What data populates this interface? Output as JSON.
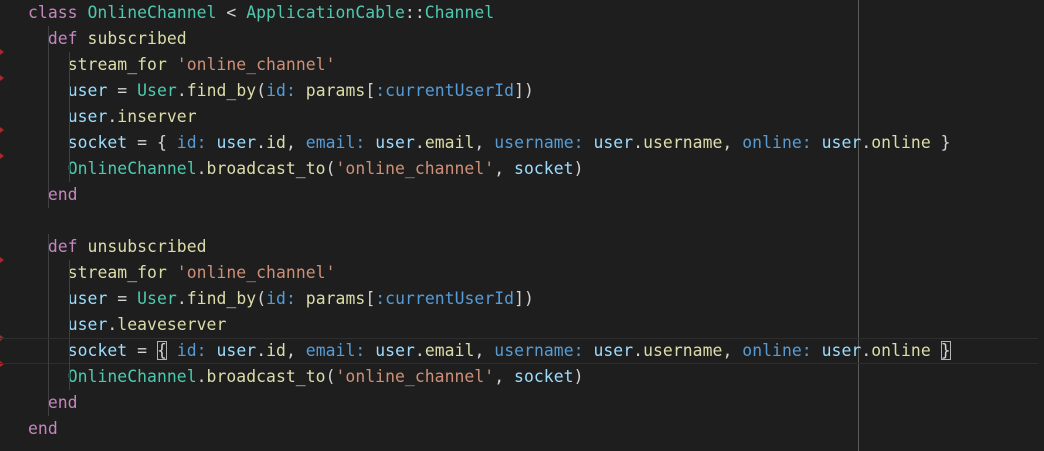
{
  "editor": {
    "language": "ruby",
    "colors": {
      "background": "#1e1e1e",
      "keyword": "#c586c0",
      "class": "#4ec9b0",
      "function": "#dcdcaa",
      "variable": "#9cdcfe",
      "string": "#ce9178",
      "symbol": "#569cd6",
      "plain": "#d4d4d4",
      "git_marker": "#a8282c"
    },
    "current_line": 14,
    "lines": [
      {
        "indent": 0,
        "tokens": [
          [
            "kw",
            "class"
          ],
          [
            "op",
            " "
          ],
          [
            "cls",
            "OnlineChannel"
          ],
          [
            "op",
            " < "
          ],
          [
            "cls",
            "ApplicationCable"
          ],
          [
            "op",
            "::"
          ],
          [
            "cls",
            "Channel"
          ]
        ]
      },
      {
        "indent": 1,
        "tokens": [
          [
            "kw",
            "def"
          ],
          [
            "op",
            " "
          ],
          [
            "fn",
            "subscribed"
          ]
        ]
      },
      {
        "indent": 2,
        "tokens": [
          [
            "fn",
            "stream_for"
          ],
          [
            "op",
            " "
          ],
          [
            "str",
            "'online_channel'"
          ]
        ]
      },
      {
        "indent": 2,
        "tokens": [
          [
            "var",
            "user"
          ],
          [
            "op",
            " = "
          ],
          [
            "cls",
            "User"
          ],
          [
            "op",
            "."
          ],
          [
            "fn",
            "find_by"
          ],
          [
            "op",
            "("
          ],
          [
            "sym",
            "id:"
          ],
          [
            "op",
            " "
          ],
          [
            "fn",
            "params"
          ],
          [
            "op",
            "["
          ],
          [
            "sym",
            ":currentUserId"
          ],
          [
            "op",
            "])"
          ]
        ]
      },
      {
        "indent": 2,
        "tokens": [
          [
            "var",
            "user"
          ],
          [
            "op",
            "."
          ],
          [
            "fn",
            "inserver"
          ]
        ]
      },
      {
        "indent": 2,
        "tokens": [
          [
            "var",
            "socket"
          ],
          [
            "op",
            " = { "
          ],
          [
            "sym",
            "id:"
          ],
          [
            "op",
            " "
          ],
          [
            "var",
            "user"
          ],
          [
            "op",
            "."
          ],
          [
            "fn",
            "id"
          ],
          [
            "op",
            ", "
          ],
          [
            "sym",
            "email:"
          ],
          [
            "op",
            " "
          ],
          [
            "var",
            "user"
          ],
          [
            "op",
            "."
          ],
          [
            "fn",
            "email"
          ],
          [
            "op",
            ", "
          ],
          [
            "sym",
            "username:"
          ],
          [
            "op",
            " "
          ],
          [
            "var",
            "user"
          ],
          [
            "op",
            "."
          ],
          [
            "fn",
            "username"
          ],
          [
            "op",
            ", "
          ],
          [
            "sym",
            "online:"
          ],
          [
            "op",
            " "
          ],
          [
            "var",
            "user"
          ],
          [
            "op",
            "."
          ],
          [
            "fn",
            "online"
          ],
          [
            "op",
            " }"
          ]
        ]
      },
      {
        "indent": 2,
        "tokens": [
          [
            "cls",
            "OnlineChannel"
          ],
          [
            "op",
            "."
          ],
          [
            "fn",
            "broadcast_to"
          ],
          [
            "op",
            "("
          ],
          [
            "str",
            "'online_channel'"
          ],
          [
            "op",
            ", "
          ],
          [
            "var",
            "socket"
          ],
          [
            "op",
            ")"
          ]
        ]
      },
      {
        "indent": 1,
        "tokens": [
          [
            "kw",
            "end"
          ]
        ]
      },
      {
        "indent": 0,
        "tokens": []
      },
      {
        "indent": 1,
        "tokens": [
          [
            "kw",
            "def"
          ],
          [
            "op",
            " "
          ],
          [
            "fn",
            "unsubscribed"
          ]
        ]
      },
      {
        "indent": 2,
        "tokens": [
          [
            "fn",
            "stream_for"
          ],
          [
            "op",
            " "
          ],
          [
            "str",
            "'online_channel'"
          ]
        ]
      },
      {
        "indent": 2,
        "tokens": [
          [
            "var",
            "user"
          ],
          [
            "op",
            " = "
          ],
          [
            "cls",
            "User"
          ],
          [
            "op",
            "."
          ],
          [
            "fn",
            "find_by"
          ],
          [
            "op",
            "("
          ],
          [
            "sym",
            "id:"
          ],
          [
            "op",
            " "
          ],
          [
            "fn",
            "params"
          ],
          [
            "op",
            "["
          ],
          [
            "sym",
            ":currentUserId"
          ],
          [
            "op",
            "])"
          ]
        ]
      },
      {
        "indent": 2,
        "tokens": [
          [
            "var",
            "user"
          ],
          [
            "op",
            "."
          ],
          [
            "fn",
            "leaveserver"
          ]
        ]
      },
      {
        "indent": 2,
        "tokens": [
          [
            "var",
            "socket"
          ],
          [
            "op",
            " = "
          ],
          [
            "bro",
            "{"
          ],
          [
            "op",
            " "
          ],
          [
            "sym",
            "id:"
          ],
          [
            "op",
            " "
          ],
          [
            "var",
            "user"
          ],
          [
            "op",
            "."
          ],
          [
            "fn",
            "id"
          ],
          [
            "op",
            ", "
          ],
          [
            "sym",
            "email:"
          ],
          [
            "op",
            " "
          ],
          [
            "var",
            "user"
          ],
          [
            "op",
            "."
          ],
          [
            "fn",
            "email"
          ],
          [
            "op",
            ", "
          ],
          [
            "sym",
            "username:"
          ],
          [
            "op",
            " "
          ],
          [
            "var",
            "user"
          ],
          [
            "op",
            "."
          ],
          [
            "fn",
            "username"
          ],
          [
            "op",
            ", "
          ],
          [
            "sym",
            "online:"
          ],
          [
            "op",
            " "
          ],
          [
            "var",
            "user"
          ],
          [
            "op",
            "."
          ],
          [
            "fn",
            "online"
          ],
          [
            "op",
            " "
          ],
          [
            "brc",
            "}"
          ]
        ]
      },
      {
        "indent": 2,
        "tokens": [
          [
            "cls",
            "OnlineChannel"
          ],
          [
            "op",
            "."
          ],
          [
            "fn",
            "broadcast_to"
          ],
          [
            "op",
            "("
          ],
          [
            "str",
            "'online_channel'"
          ],
          [
            "op",
            ", "
          ],
          [
            "var",
            "socket"
          ],
          [
            "op",
            ")"
          ]
        ]
      },
      {
        "indent": 1,
        "tokens": [
          [
            "kw",
            "end"
          ]
        ]
      },
      {
        "indent": 0,
        "tokens": [
          [
            "kw",
            "end"
          ]
        ]
      }
    ],
    "git_markers": [
      2,
      3,
      5,
      6,
      10,
      13,
      14
    ]
  }
}
